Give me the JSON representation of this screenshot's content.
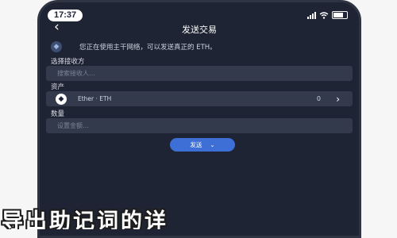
{
  "status_bar": {
    "time": "17:37"
  },
  "nav": {
    "back_icon": "‹",
    "title": "发送交易"
  },
  "notice": {
    "icon": "eth-icon",
    "text": "您正在使用主干网络，可以发送真正的 ETH。"
  },
  "recipient": {
    "label": "选择接收方",
    "placeholder": "搜索接收人..."
  },
  "asset": {
    "label": "资产",
    "name": "Ether · ETH",
    "balance": "0",
    "chevron": "›"
  },
  "amount": {
    "label": "数量",
    "placeholder": "设置金额..."
  },
  "next_button": {
    "label": "发送",
    "chevron": "⌄"
  },
  "caption": {
    "text": "导出助记词的详"
  },
  "colors": {
    "background": "#1e2433",
    "field": "#323a4b",
    "accent": "#3e6fd6"
  }
}
